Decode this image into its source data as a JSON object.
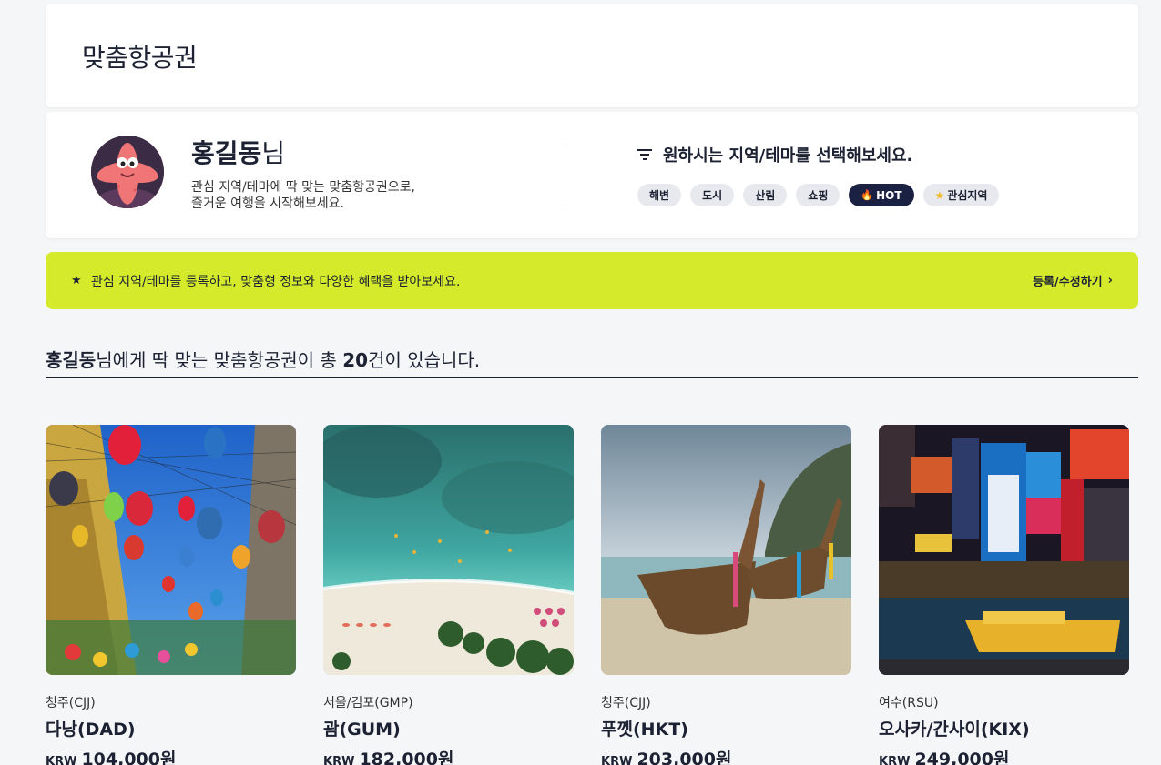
{
  "page": {
    "title": "맞춤항공권"
  },
  "profile": {
    "name": "홍길동",
    "honorific": "님",
    "intro_line1": "관심 지역/테마에 딱 맞는 맞춤항공권으로,",
    "intro_line2": "즐거운 여행을 시작해보세요."
  },
  "filter": {
    "heading": "원하시는 지역/테마를 선택해보세요.",
    "chips": [
      "해변",
      "도시",
      "산림",
      "쇼핑",
      "HOT",
      "관심지역"
    ]
  },
  "banner": {
    "message": "관심 지역/테마를 등록하고, 맞춤형 정보와 다양한 혜택을 받아보세요.",
    "link": "등록/수정하기"
  },
  "summary": {
    "name": "홍길동",
    "middle": "님에게 딱 맞는 맞춤항공권이 총 ",
    "count": "20",
    "tail": "건이 있습니다."
  },
  "flights": [
    {
      "origin": "청주(CJJ)",
      "destination": "다낭(DAD)",
      "currency": "KRW",
      "price": "104,000원"
    },
    {
      "origin": "서울/김포(GMP)",
      "destination": "괌(GUM)",
      "currency": "KRW",
      "price": "182,000원"
    },
    {
      "origin": "청주(CJJ)",
      "destination": "푸껫(HKT)",
      "currency": "KRW",
      "price": "203,000원"
    },
    {
      "origin": "여수(RSU)",
      "destination": "오사카/간사이(KIX)",
      "currency": "KRW",
      "price": "249,000원"
    }
  ],
  "colors": {
    "banner": "#d4ea2b",
    "navy": "#1a2142",
    "chip": "#e7e9ee"
  }
}
